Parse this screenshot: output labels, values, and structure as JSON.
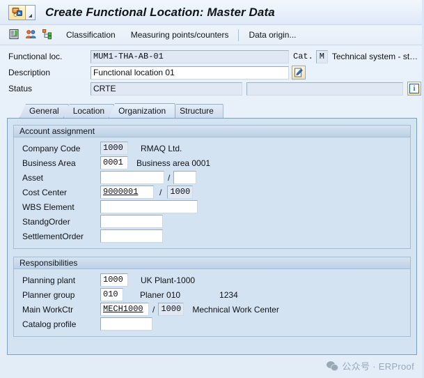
{
  "window": {
    "title": "Create Functional Location: Master Data",
    "system_icon": "sap-system-icon",
    "menu_arrow_icon": "dropdown-arrow-icon"
  },
  "toolbar": {
    "icons": [
      {
        "name": "classification-list-icon"
      },
      {
        "name": "partners-people-icon"
      },
      {
        "name": "structure-hierarchy-icon"
      }
    ],
    "items": [
      {
        "label": "Classification"
      },
      {
        "label": "Measuring points/counters"
      },
      {
        "label": "Data origin..."
      }
    ]
  },
  "header": {
    "functional_loc": {
      "label": "Functional loc.",
      "value": "MUM1-THA-AB-01",
      "readonly": true
    },
    "category": {
      "label": "Cat.",
      "value": "M",
      "description": "Technical system - st…"
    },
    "description": {
      "label": "Description",
      "value": "Functional location 01",
      "edit_icon": "pencil-edit-icon"
    },
    "status": {
      "label": "Status",
      "value": "CRTE",
      "secondary_value": "",
      "info_icon": "info-i-icon"
    }
  },
  "tabs": [
    {
      "label": "General",
      "selected": false
    },
    {
      "label": "Location",
      "selected": false
    },
    {
      "label": "Organization",
      "selected": true
    },
    {
      "label": "Structure",
      "selected": false
    }
  ],
  "account_assignment": {
    "title": "Account assignment",
    "rows": [
      {
        "label": "Company Code",
        "value": "1000",
        "readonly": true,
        "underline": false,
        "desc": "RMAQ Ltd.",
        "second": null,
        "second_ro": false
      },
      {
        "label": "Business Area",
        "value": "0001",
        "readonly": false,
        "underline": false,
        "desc": "Business area 0001",
        "second": null,
        "second_ro": false
      },
      {
        "label": "Asset",
        "value": "",
        "readonly": false,
        "underline": false,
        "desc": "",
        "second": "",
        "second_ro": false
      },
      {
        "label": "Cost Center",
        "value": "9000001",
        "readonly": false,
        "underline": true,
        "desc": "",
        "second": "1000",
        "second_ro": true
      },
      {
        "label": "WBS Element",
        "value": "",
        "readonly": false,
        "underline": false,
        "desc": "",
        "second": null,
        "second_ro": false
      },
      {
        "label": "StandgOrder",
        "value": "",
        "readonly": false,
        "underline": false,
        "desc": "",
        "second": null,
        "second_ro": false
      },
      {
        "label": "SettlementOrder",
        "value": "",
        "readonly": false,
        "underline": false,
        "desc": "",
        "second": null,
        "second_ro": false
      }
    ]
  },
  "responsibilities": {
    "title": "Responsibilities",
    "rows": [
      {
        "label": "Planning plant",
        "value": "1000",
        "underline": false,
        "desc": "UK Plant-1000",
        "extra": "",
        "second": null,
        "second_ro": false
      },
      {
        "label": "Planner group",
        "value": "010",
        "underline": false,
        "desc": "Planer 010",
        "extra": "1234",
        "second": null,
        "second_ro": false
      },
      {
        "label": "Main WorkCtr",
        "value": "MECH1000",
        "underline": true,
        "desc": "Mechnical Work Center",
        "extra": "",
        "second": "1000",
        "second_ro": true
      },
      {
        "label": "Catalog profile",
        "value": "",
        "underline": false,
        "desc": "",
        "extra": "",
        "second": null,
        "second_ro": false
      }
    ]
  },
  "watermark": {
    "icon": "wechat-icon",
    "text": "公众号 · ERProof"
  },
  "colors": {
    "window_bg": "#e4eef8",
    "panel_bg": "#d4e3f2",
    "panel_border": "#7b9ec4",
    "group_header": "#bdd1e6",
    "field_border": "#9aaabb",
    "readonly_field": "#dfe8f3",
    "accent_blue": "#1e5fa8"
  }
}
